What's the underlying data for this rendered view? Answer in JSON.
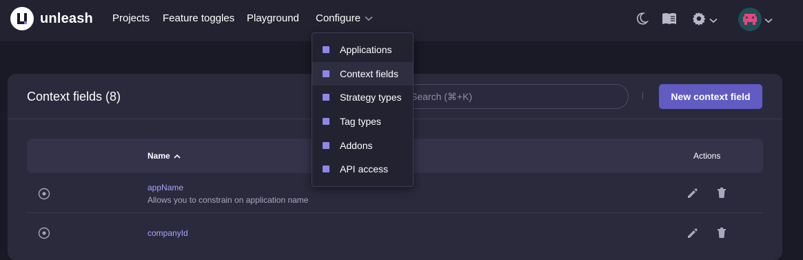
{
  "app": {
    "brand": "unleash",
    "accent": "#615bc2"
  },
  "nav": {
    "projects": "Projects",
    "feature_toggles": "Feature toggles",
    "playground": "Playground",
    "configure": "Configure"
  },
  "top_icons": [
    "moon-icon",
    "book-icon",
    "gear-icon",
    "avatar"
  ],
  "configure_menu": {
    "items": [
      {
        "label": "Applications",
        "active": false
      },
      {
        "label": "Context fields",
        "active": true
      },
      {
        "label": "Strategy types",
        "active": false
      },
      {
        "label": "Tag types",
        "active": false
      },
      {
        "label": "Addons",
        "active": false
      },
      {
        "label": "API access",
        "active": false
      }
    ]
  },
  "page": {
    "title": "Context fields (8)",
    "search_placeholder": "Search (⌘+K)",
    "new_button": "New context field"
  },
  "table": {
    "headers": {
      "name": "Name",
      "actions": "Actions"
    },
    "rows": [
      {
        "name": "appName",
        "description": "Allows you to constrain on application name"
      },
      {
        "name": "companyId",
        "description": ""
      }
    ]
  }
}
